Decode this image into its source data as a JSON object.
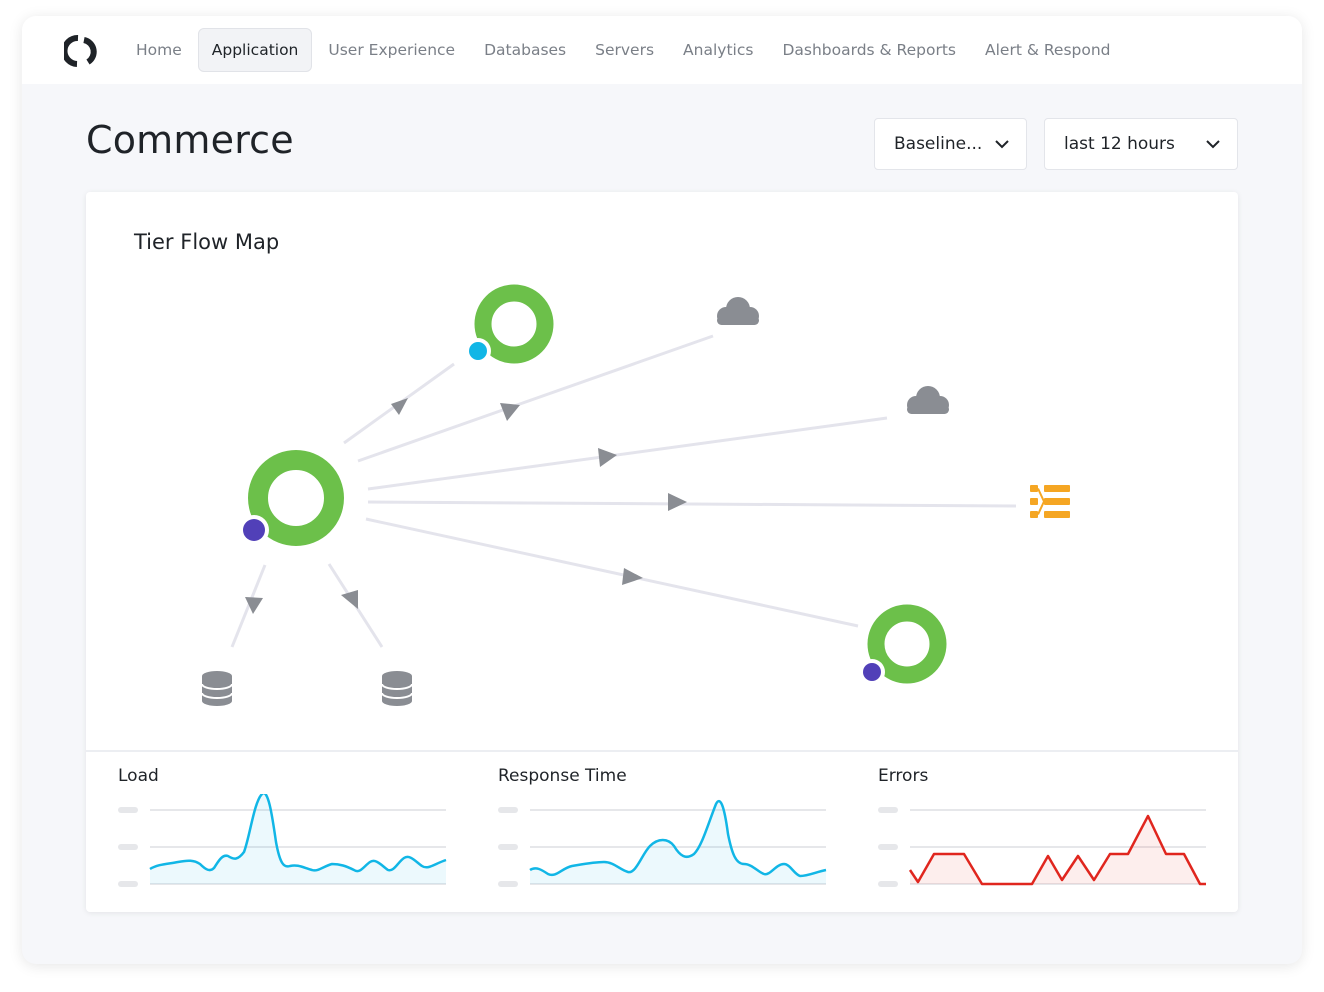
{
  "nav": {
    "items": [
      {
        "label": "Home",
        "active": false
      },
      {
        "label": "Application",
        "active": true
      },
      {
        "label": "User Experience",
        "active": false
      },
      {
        "label": "Databases",
        "active": false
      },
      {
        "label": "Servers",
        "active": false
      },
      {
        "label": "Analytics",
        "active": false
      },
      {
        "label": "Dashboards & Reports",
        "active": false
      },
      {
        "label": "Alert & Respond",
        "active": false
      }
    ]
  },
  "page": {
    "title": "Commerce"
  },
  "filters": {
    "baseline_label": "Baseline...",
    "time_range_label": "last 12 hours"
  },
  "flow_map": {
    "title": "Tier Flow Map",
    "colors": {
      "healthy": "#6cc04a",
      "node_dot_primary": "#5140b8",
      "node_dot_secondary": "#11b6e6",
      "cloud": "#8a8d93",
      "database": "#8a8d93",
      "queue": "#f5a623",
      "edge": "#e4e4ec",
      "arrow": "#8a8d93"
    },
    "nodes": [
      {
        "name": "main-tier",
        "icon": "tier-ring"
      },
      {
        "name": "top-tier",
        "icon": "tier-ring"
      },
      {
        "name": "right-tier",
        "icon": "tier-ring"
      },
      {
        "name": "cloud-service-1",
        "icon": "cloud-icon"
      },
      {
        "name": "cloud-service-2",
        "icon": "cloud-icon"
      },
      {
        "name": "message-queue",
        "icon": "queue-icon"
      },
      {
        "name": "database-1",
        "icon": "database-icon"
      },
      {
        "name": "database-2",
        "icon": "database-icon"
      }
    ]
  },
  "metrics": [
    {
      "label": "Load",
      "color": "#11b6e6"
    },
    {
      "label": "Response Time",
      "color": "#11b6e6"
    },
    {
      "label": "Errors",
      "color": "#e0261e"
    }
  ]
}
